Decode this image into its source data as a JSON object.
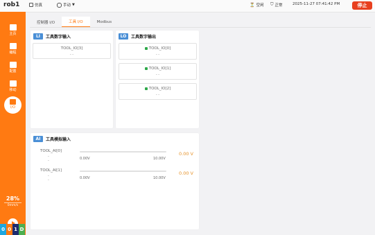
{
  "topbar": {
    "robot_name": "rob1",
    "sim_label": "仿真",
    "mode_label": "手动",
    "idle_label": "空闲",
    "status_label": "正常",
    "datetime": "2025-11-27 07:41:42 PM",
    "stop_label": "停止"
  },
  "sidebar": {
    "items": [
      {
        "label": "主页",
        "icon": "home-icon"
      },
      {
        "label": "编程",
        "icon": "code-icon"
      },
      {
        "label": "配置",
        "icon": "settings-icon"
      },
      {
        "label": "移动",
        "icon": "move-icon"
      },
      {
        "label": "I/O",
        "icon": "io-icon"
      }
    ],
    "speed_percent": "28%",
    "speed_unit": "0mm/s",
    "io_strip": [
      "0",
      "0",
      "1",
      "D"
    ],
    "colors": {
      "sidebar": "#ff7a12",
      "strip": [
        "#1ea7e0",
        "#ff7a12",
        "#1e2b6e",
        "#4caf50"
      ]
    }
  },
  "tabs": [
    {
      "label": "控制器 I/O",
      "active": false
    },
    {
      "label": "工具 I/O",
      "active": true
    },
    {
      "label": "Modbus",
      "active": false
    }
  ],
  "digital_in": {
    "badge": "LI",
    "title": "工具数字输入",
    "items": [
      {
        "label": "TOOL_IO[3]",
        "value": "- -"
      }
    ]
  },
  "digital_out": {
    "badge": "LO",
    "title": "工具数字输出",
    "items": [
      {
        "label": "TOOL_IO[0]",
        "value": "- -"
      },
      {
        "label": "TOOL_IO[1]",
        "value": "- -"
      },
      {
        "label": "TOOL_IO[2]",
        "value": "- -"
      }
    ]
  },
  "analog_in": {
    "badge": "AI",
    "title": "工具模拟输入",
    "items": [
      {
        "label": "TOOL_AI[0]",
        "value": "- -",
        "min": "0.00V",
        "max": "10.00V",
        "reading": "0.00 V"
      },
      {
        "label": "TOOL_AI[1]",
        "value": "- -",
        "min": "0.00V",
        "max": "10.00V",
        "reading": "0.00 V"
      }
    ]
  }
}
